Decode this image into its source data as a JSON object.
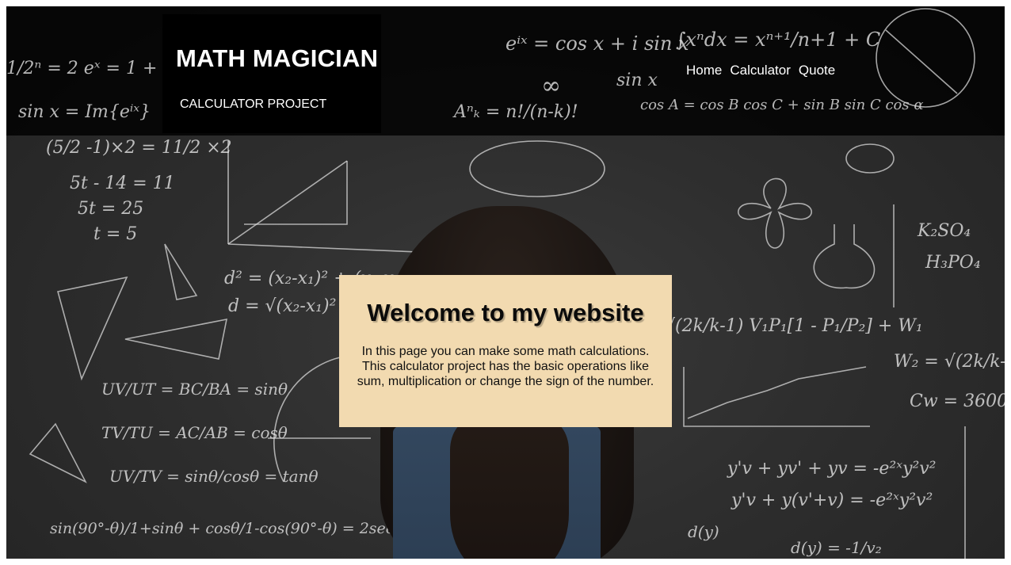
{
  "header": {
    "title": "MATH MAGICIAN",
    "subtitle": "CALCULATOR PROJECT",
    "nav": [
      {
        "label": "Home"
      },
      {
        "label": "Calculator"
      },
      {
        "label": "Quote"
      }
    ]
  },
  "welcome": {
    "heading": "Welcome to my website",
    "body": "In this page you can make some math calculations. This calculator project has the basic operations like sum, multiplication or change the sign of the number."
  },
  "background": {
    "description_icon": "chalkboard-math-background",
    "colors": {
      "header_overlay": "#000000",
      "card": "#f2dab0",
      "board": "#2e2e2e"
    }
  }
}
